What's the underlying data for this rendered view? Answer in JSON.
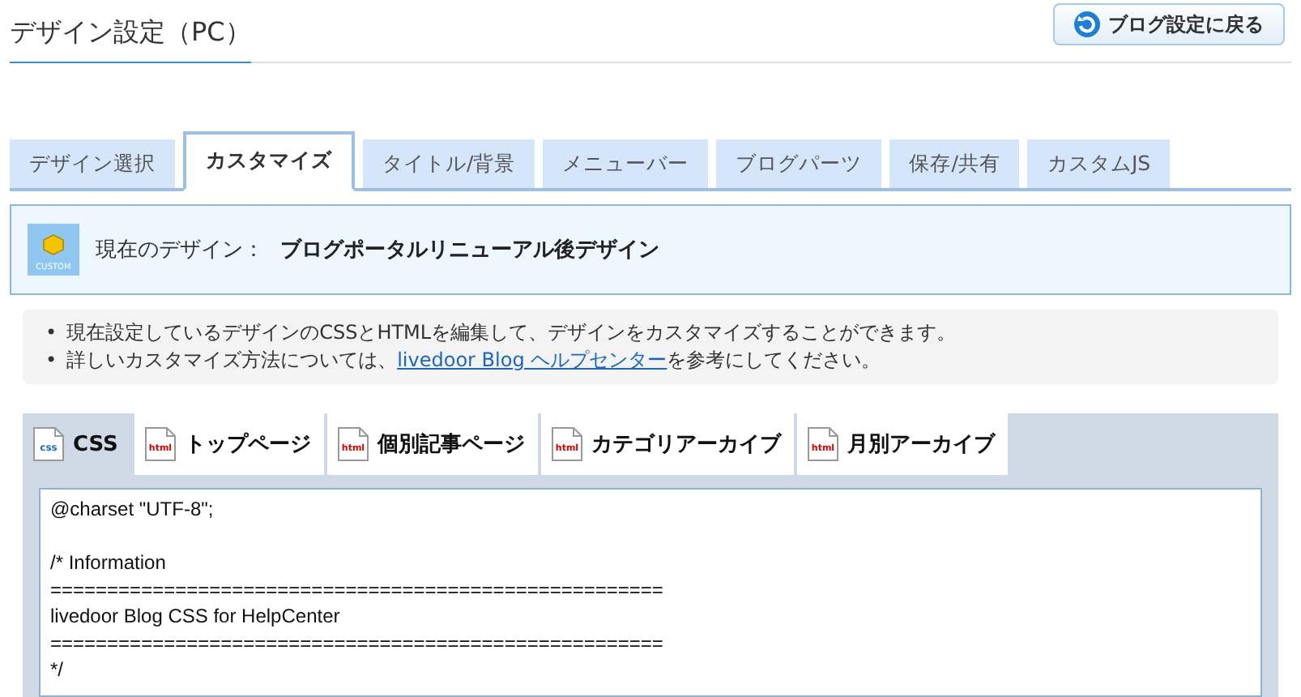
{
  "header": {
    "title": "デザイン設定（PC）",
    "back_button": "ブログ設定に戻る"
  },
  "tabs": [
    {
      "label": "デザイン選択",
      "selected": false
    },
    {
      "label": "カスタマイズ",
      "selected": true
    },
    {
      "label": "タイトル/背景",
      "selected": false
    },
    {
      "label": "メニューバー",
      "selected": false
    },
    {
      "label": "ブログパーツ",
      "selected": false
    },
    {
      "label": "保存/共有",
      "selected": false
    },
    {
      "label": "カスタムJS",
      "selected": false
    }
  ],
  "current_design": {
    "icon_label": "CUSTOM",
    "label": "現在のデザイン：",
    "name": "ブログポータルリニューアル後デザイン"
  },
  "notes": [
    {
      "bullet": "•",
      "text": "現在設定しているデザインのCSSとHTMLを編集して、デザインをカスタマイズすることができます。"
    },
    {
      "bullet": "•",
      "text": "詳しいカスタマイズ方法については、",
      "link": "livedoor Blog ヘルプセンター",
      "after": "を参考にしてください。"
    }
  ],
  "file_tabs": [
    {
      "kind": "css",
      "icon_label": "css",
      "label": "CSS",
      "selected": true
    },
    {
      "kind": "html",
      "icon_label": "html",
      "label": "トップページ",
      "selected": false
    },
    {
      "kind": "html",
      "icon_label": "html",
      "label": "個別記事ページ",
      "selected": false
    },
    {
      "kind": "html",
      "icon_label": "html",
      "label": "カテゴリアーカイブ",
      "selected": false
    },
    {
      "kind": "html",
      "icon_label": "html",
      "label": "月別アーカイブ",
      "selected": false
    }
  ],
  "editor": {
    "value": "@charset \"UTF-8\";\n\n/* Information\n======================================================\nlivedoor Blog CSS for HelpCenter\n======================================================\n*/"
  }
}
